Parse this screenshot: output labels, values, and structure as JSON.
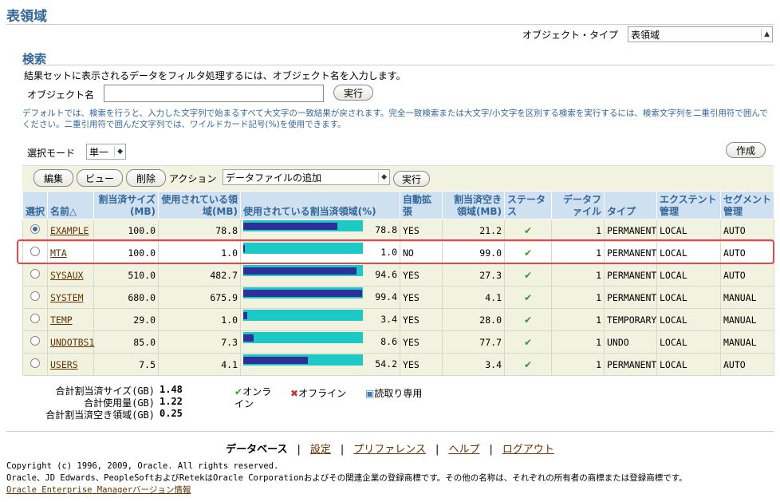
{
  "page": {
    "title": "表領域"
  },
  "object_type": {
    "label": "オブジェクト・タイプ",
    "value": "表領域"
  },
  "search": {
    "title": "検索",
    "instruction": "結果セットに表示されるデータをフィルタ処理するには、オブジェクト名を入力します。",
    "object_name_label": "オブジェクト名",
    "object_name_value": "",
    "go_label": "実行",
    "tip": "デフォルトでは、検索を行うと、入力した文字列で始まるすべて大文字の一致結果が戻されます。完全一致検索または大文字/小文字を区別する検索を実行するには、検索文字列を二重引用符で囲んでください。二重引用符で囲んだ文字列では、ワイルドカード記号(%)を使用できます。"
  },
  "selection": {
    "label": "選択モード",
    "value": "単一"
  },
  "create_label": "作成",
  "toolbar": {
    "edit_label": "編集",
    "view_label": "ビュー",
    "delete_label": "削除",
    "action_label": "アクション",
    "action_value": "データファイルの追加",
    "execute_label": "実行"
  },
  "columns": {
    "select": "選択",
    "name": "名前△",
    "allocated_size": "割当済サイズ(MB)",
    "used_space": "使用されている領域(MB)",
    "used_pct": "使用されている割当済領域(%)",
    "autoextend": "自動拡張",
    "free_space": "割当済空き領域(MB)",
    "status": "ステータス",
    "datafiles": "データファイル",
    "type": "タイプ",
    "extent_mgmt": "エクステント管理",
    "segment_mgmt": "セグメント管理"
  },
  "rows": [
    {
      "selected": true,
      "name": "EXAMPLE",
      "allocated": "100.0",
      "used": "78.8",
      "pct": "78.8",
      "autoext": "YES",
      "free": "21.2",
      "status": "✔",
      "files": "1",
      "type": "PERMANENT",
      "extent": "LOCAL",
      "segment": "AUTO"
    },
    {
      "selected": false,
      "name": "MTA",
      "allocated": "100.0",
      "used": "1.0",
      "pct": "1.0",
      "autoext": "NO",
      "free": "99.0",
      "status": "✔",
      "files": "1",
      "type": "PERMANENT",
      "extent": "LOCAL",
      "segment": "AUTO"
    },
    {
      "selected": false,
      "name": "SYSAUX",
      "allocated": "510.0",
      "used": "482.7",
      "pct": "94.6",
      "autoext": "YES",
      "free": "27.3",
      "status": "✔",
      "files": "1",
      "type": "PERMANENT",
      "extent": "LOCAL",
      "segment": "AUTO"
    },
    {
      "selected": false,
      "name": "SYSTEM",
      "allocated": "680.0",
      "used": "675.9",
      "pct": "99.4",
      "autoext": "YES",
      "free": "4.1",
      "status": "✔",
      "files": "1",
      "type": "PERMANENT",
      "extent": "LOCAL",
      "segment": "MANUAL"
    },
    {
      "selected": false,
      "name": "TEMP",
      "allocated": "29.0",
      "used": "1.0",
      "pct": "3.4",
      "autoext": "YES",
      "free": "28.0",
      "status": "✔",
      "files": "1",
      "type": "TEMPORARY",
      "extent": "LOCAL",
      "segment": "MANUAL"
    },
    {
      "selected": false,
      "name": "UNDOTBS1",
      "allocated": "85.0",
      "used": "7.3",
      "pct": "8.6",
      "autoext": "YES",
      "free": "77.7",
      "status": "✔",
      "files": "1",
      "type": "UNDO",
      "extent": "LOCAL",
      "segment": "MANUAL"
    },
    {
      "selected": false,
      "name": "USERS",
      "allocated": "7.5",
      "used": "4.1",
      "pct": "54.2",
      "autoext": "YES",
      "free": "3.4",
      "status": "✔",
      "files": "1",
      "type": "PERMANENT",
      "extent": "LOCAL",
      "segment": "AUTO"
    }
  ],
  "colors": {
    "bar_bg": "#1cc9c4",
    "bar_fill": "#2f2f9a",
    "highlight": "#e0484f",
    "header_bg": "#cfe0f1",
    "accent": "#336699"
  },
  "summary": {
    "total_allocated_label": "合計割当済サイズ(GB)",
    "total_allocated": "1.48",
    "total_used_label": "合計使用量(GB)",
    "total_used": "1.22",
    "total_free_label": "合計割当済空き領域(GB)",
    "total_free": "0.25"
  },
  "legend": {
    "online": "オンライン",
    "offline": "オフライン",
    "readonly": "読取り専用"
  },
  "footer": {
    "database": "データベース",
    "setup": "設定",
    "preferences": "プリファレンス",
    "help": "ヘルプ",
    "logout": "ログアウト",
    "copyright": "Copyright (c) 1996, 2009, Oracle. All rights reserved.",
    "trademark": "Oracle、JD Edwards、PeopleSoftおよびRetekはOracle Corporationおよびその関連企業の登録商標です。その他の名称は、それぞれの所有者の商標または登録商標です。",
    "version_link": "Oracle Enterprise Managerバージョン情報"
  }
}
